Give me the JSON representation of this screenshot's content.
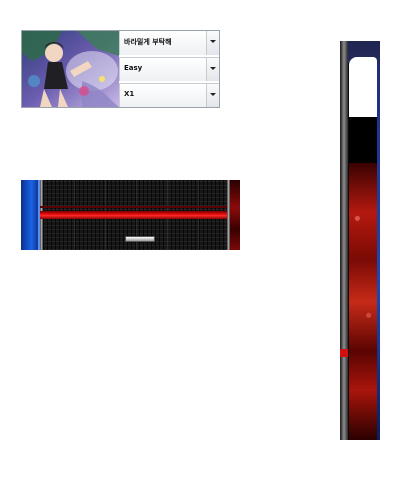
{
  "song_select": {
    "title_value": "바라밀게 부탁해",
    "difficulty_value": "Easy",
    "speed_value": "X1",
    "cover_art": "anime-illustration-cover",
    "dropdown_icon": "chevron-down-icon"
  },
  "lane_preview": {
    "lane_count": 6,
    "judge_line_color": "#e50b0b",
    "lane_background": "#161616",
    "side_panel_color": "#1b63e8",
    "note_color": "#e6e6e6"
  },
  "skin_strip": {
    "top_panel_color": "#ffffff",
    "body_color": "#b4190f",
    "edge_color": "#1d47b5"
  }
}
